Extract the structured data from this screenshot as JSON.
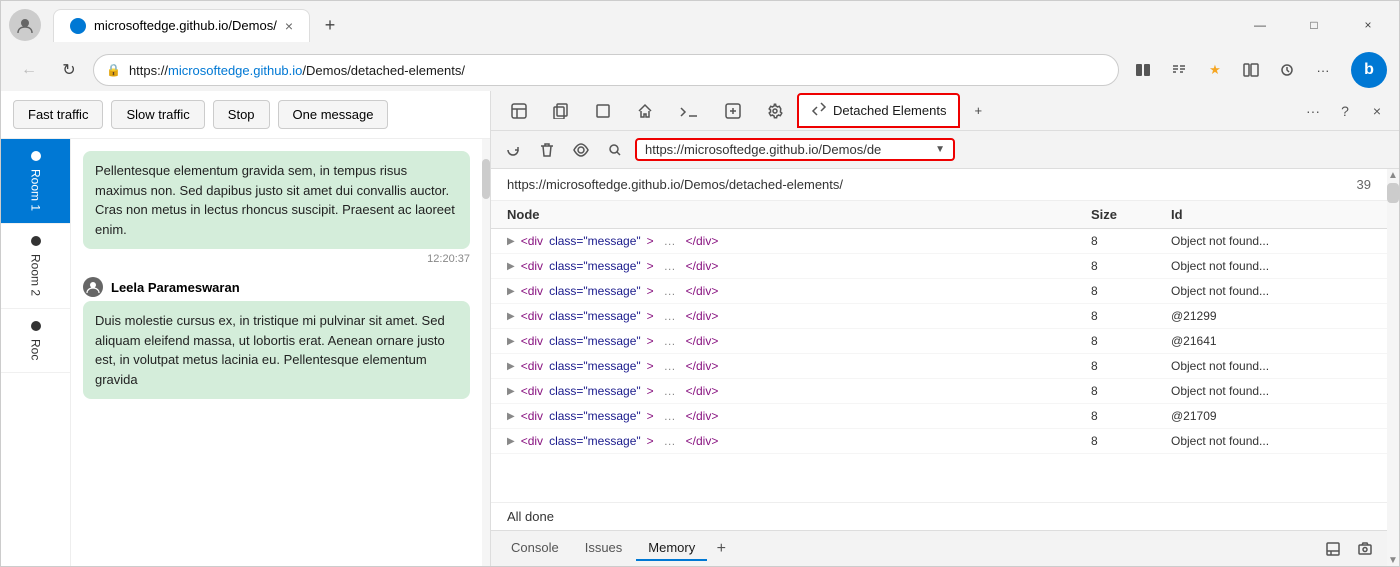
{
  "browser": {
    "tab": {
      "title": "microsoftedge.github.io/Demos/",
      "close_label": "×"
    },
    "new_tab_label": "+",
    "title_bar": {
      "minimize": "—",
      "maximize": "□",
      "close": "×"
    },
    "address_bar": {
      "url_prefix": "https://",
      "url_domain": "microsoftedge.github.io",
      "url_path": "/Demos/detached-elements/",
      "full_url": "https://microsoftedge.github.io/Demos/detached-elements/"
    }
  },
  "chat": {
    "toolbar": {
      "fast_traffic": "Fast traffic",
      "slow_traffic": "Slow traffic",
      "stop": "Stop",
      "one_message": "One message"
    },
    "rooms": [
      {
        "label": "Room 1",
        "active": true
      },
      {
        "label": "Room 2",
        "active": false
      },
      {
        "label": "Roo",
        "active": false
      }
    ],
    "messages": [
      {
        "text": "Pellentesque elementum gravida sem, in tempus risus maximus non. Sed dapibus justo sit amet dui convallis auctor. Cras non metus in lectus rhoncus suscipit. Praesent ac laoreet enim.",
        "time": "12:20:37"
      },
      {
        "sender": "Leela Parameswaran",
        "text": "Duis molestie cursus ex, in tristique mi pulvinar sit amet. Sed aliquam eleifend massa, ut lobortis erat. Aenean ornare justo est, in volutpat metus lacinia eu. Pellentesque elementum gravida"
      }
    ]
  },
  "devtools": {
    "tabs": [
      {
        "label": "⬚",
        "icon": true
      },
      {
        "label": "⬚",
        "icon": true
      },
      {
        "label": "⬚",
        "icon": true
      },
      {
        "label": "⌂",
        "icon": true
      },
      {
        "label": "</>"
      },
      {
        "label": "⬚",
        "icon": true
      },
      {
        "label": "⚙",
        "icon": true
      },
      {
        "label": "Detached Elements",
        "active": true
      },
      {
        "label": "+"
      }
    ],
    "toolbar": {
      "refresh_icon": "↻",
      "delete_icon": "🗑",
      "view_icon": "◉",
      "search_icon": "🔍",
      "url_value": "https://microsoftedge.github.io/Demos/de",
      "url_dropdown": "▼"
    },
    "content": {
      "url_header": "https://microsoftedge.github.io/Demos/detached-elements/",
      "count": "39",
      "table": {
        "columns": [
          "Node",
          "Size",
          "Id"
        ],
        "rows": [
          {
            "node": "<div class=\"message\"> … </div>",
            "size": "8",
            "id": "Object not found..."
          },
          {
            "node": "<div class=\"message\"> … </div>",
            "size": "8",
            "id": "Object not found..."
          },
          {
            "node": "<div class=\"message\"> … </div>",
            "size": "8",
            "id": "Object not found..."
          },
          {
            "node": "<div class=\"message\"> … </div>",
            "size": "8",
            "id": "@21299"
          },
          {
            "node": "<div class=\"message\"> … </div>",
            "size": "8",
            "id": "@21641"
          },
          {
            "node": "<div class=\"message\"> … </div>",
            "size": "8",
            "id": "Object not found..."
          },
          {
            "node": "<div class=\"message\"> … </div>",
            "size": "8",
            "id": "Object not found..."
          },
          {
            "node": "<div class=\"message\"> … </div>",
            "size": "8",
            "id": "@21709"
          },
          {
            "node": "<div class=\"message\"> … </div>",
            "size": "8",
            "id": "Object not found..."
          }
        ]
      },
      "status": "All done"
    },
    "bottom_tabs": [
      {
        "label": "Console"
      },
      {
        "label": "Issues"
      },
      {
        "label": "Memory",
        "active": true
      }
    ]
  }
}
